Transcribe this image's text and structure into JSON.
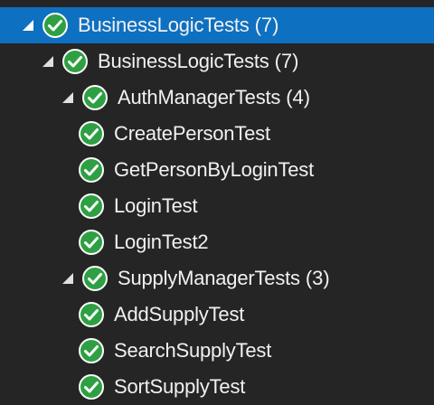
{
  "tree": {
    "root": {
      "label": "BusinessLogicTests",
      "count": "(7)"
    },
    "project": {
      "label": "BusinessLogicTests",
      "count": "(7)"
    },
    "auth": {
      "label": "AuthManagerTests",
      "count": "(4)",
      "tests": [
        "CreatePersonTest",
        "GetPersonByLoginTest",
        "LoginTest",
        "LoginTest2"
      ]
    },
    "supply": {
      "label": "SupplyManagerTests",
      "count": "(3)",
      "tests": [
        "AddSupplyTest",
        "SearchSupplyTest",
        "SortSupplyTest"
      ]
    }
  },
  "colors": {
    "background": "#252526",
    "selection": "#0e70c0",
    "pass_green": "#2ea043",
    "text": "#f1f1f1"
  },
  "icons": {
    "expander": "expanded-triangle-icon",
    "status": "passed-check-icon"
  }
}
